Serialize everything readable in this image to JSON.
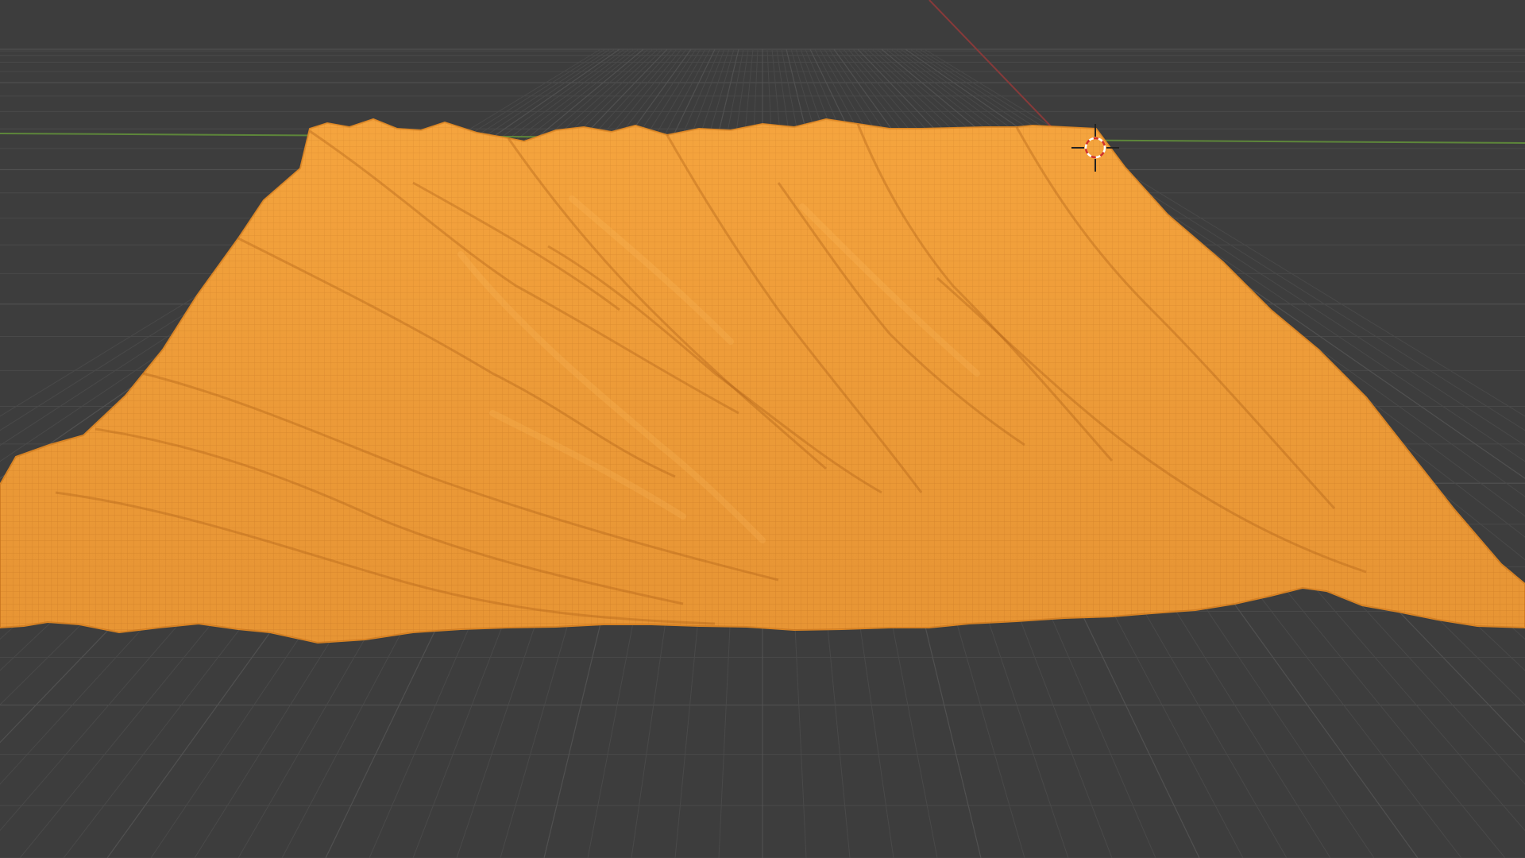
{
  "scene": {
    "editor": "3D Viewport",
    "object_type": "terrain mesh (wireframe, selected)",
    "colors": {
      "background": "#3d3d3d",
      "grid_minor": "#4a4a4a",
      "grid_major": "#525252",
      "axis_x": "#8b3a3a",
      "axis_y": "#5f8a3a",
      "selection_base": "#f2a03a",
      "selection_wire": "#b8681a",
      "selection_highlight": "#ffc066",
      "cursor_primary": "#ffffff",
      "cursor_secondary": "#d0312d"
    },
    "icons": {
      "cursor": "3d-cursor-icon"
    }
  }
}
